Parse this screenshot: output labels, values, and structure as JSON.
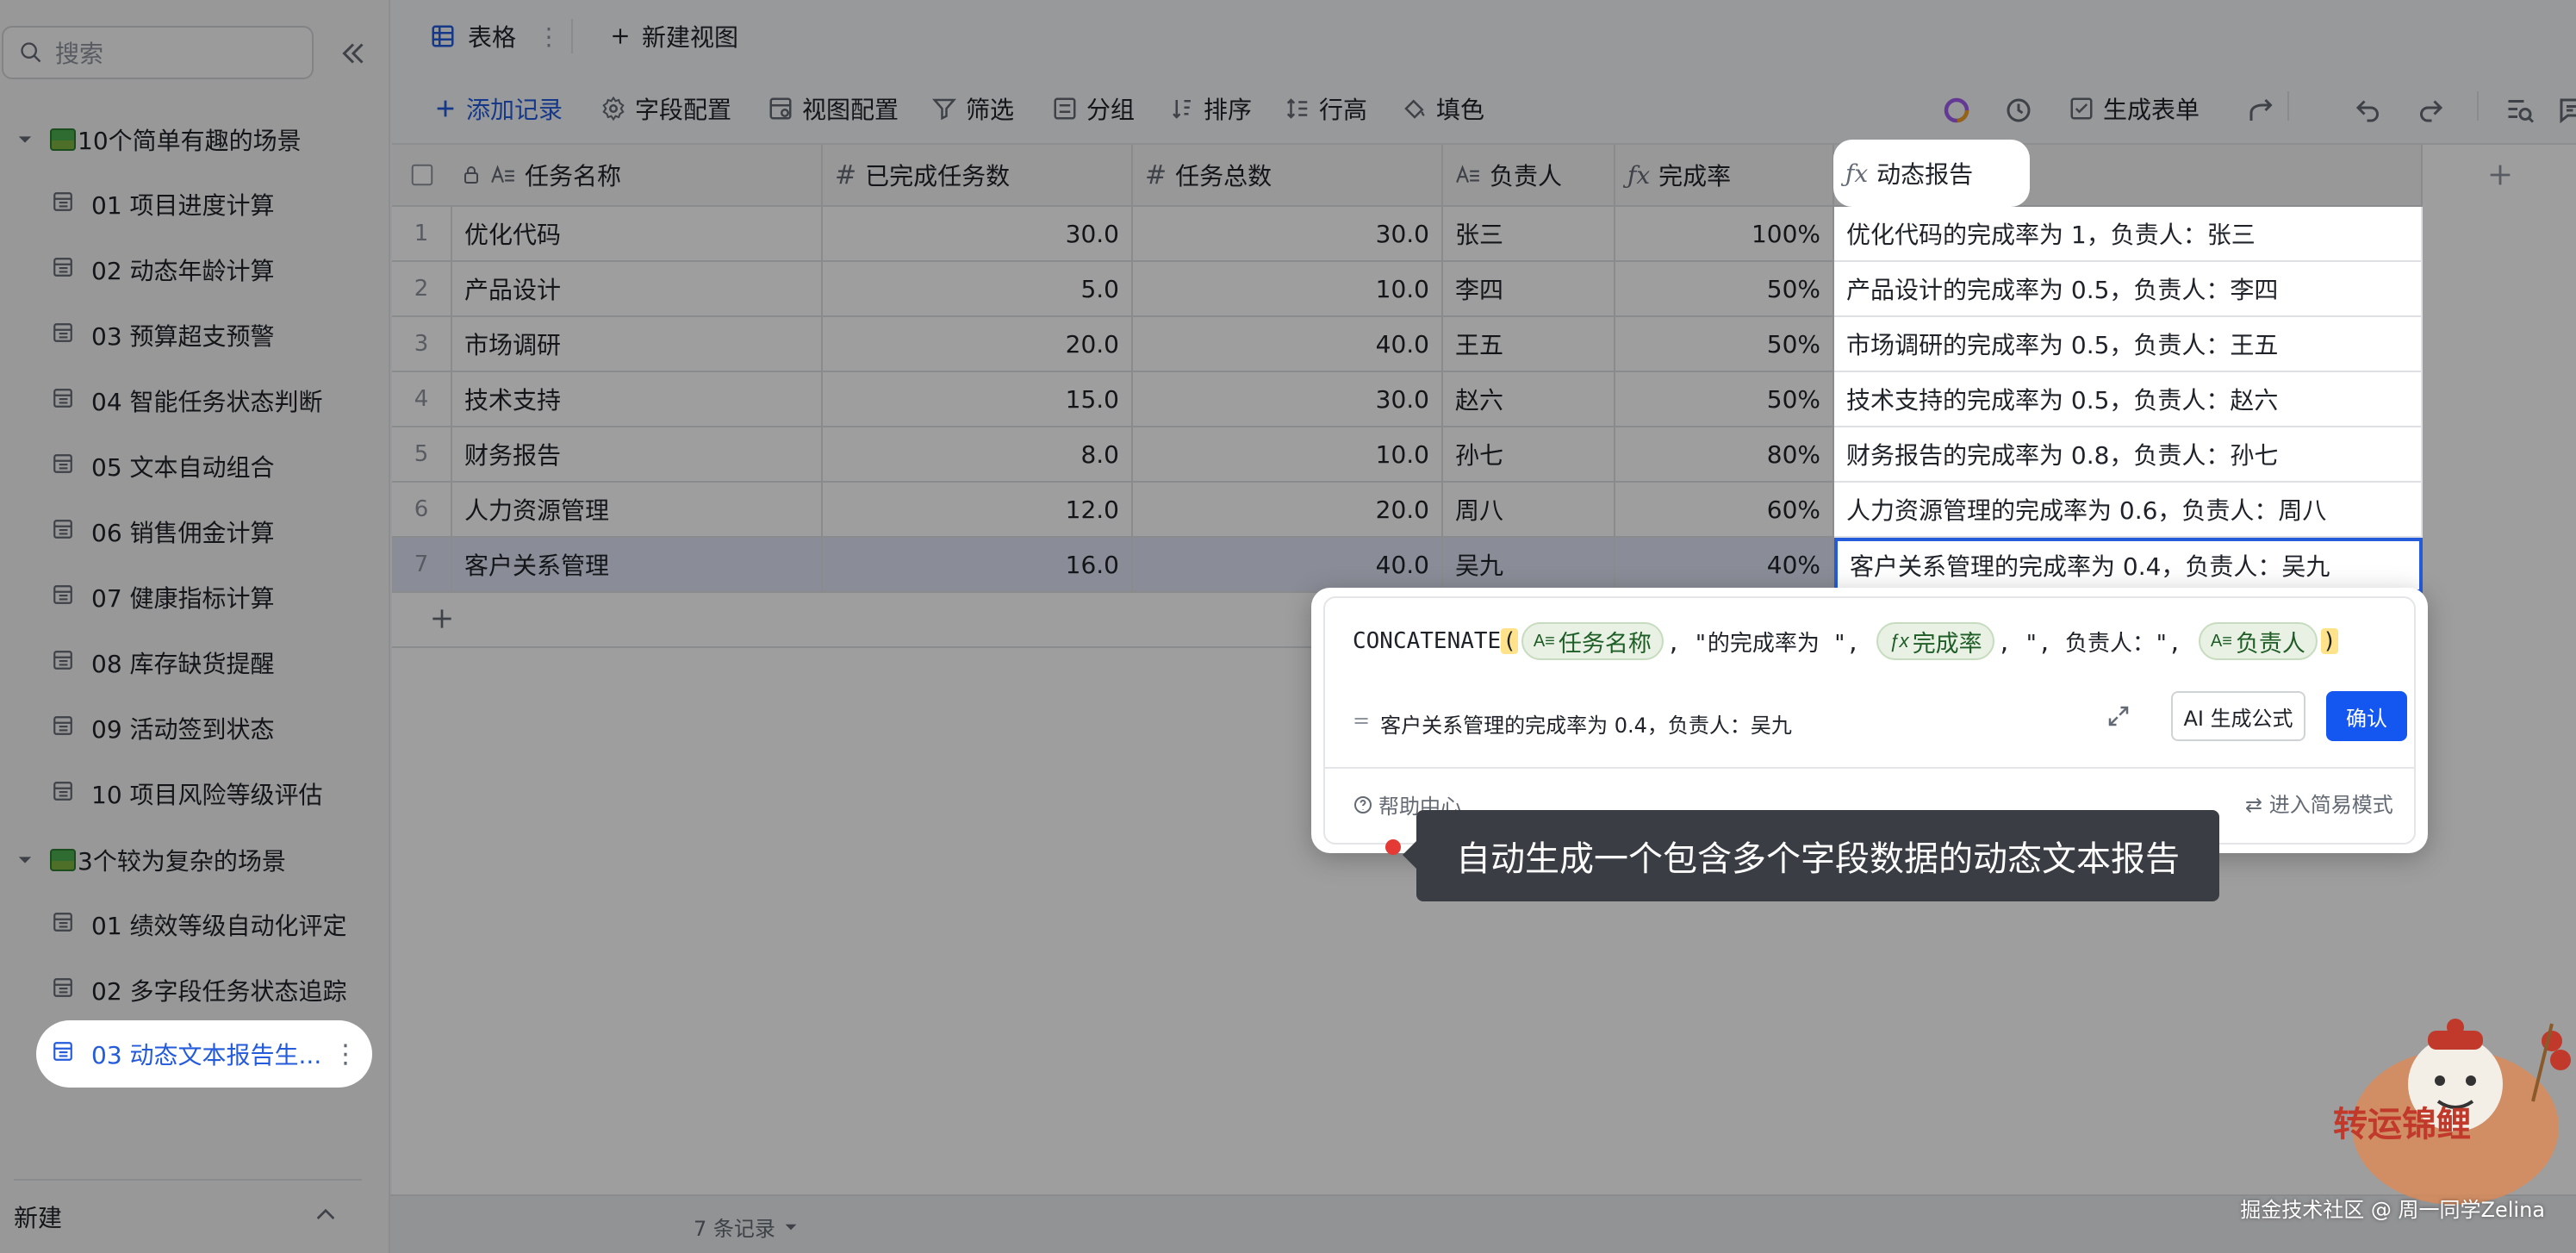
{
  "sidebar": {
    "search_placeholder": "搜索",
    "groups": [
      {
        "label": "10个简单有趣的场景"
      },
      {
        "label": "3个较为复杂的场景"
      }
    ],
    "items": [
      "01 项目进度计算",
      "02 动态年龄计算",
      "03 预算超支预警",
      "04 智能任务状态判断",
      "05 文本自动组合",
      "06 销售佣金计算",
      "07 健康指标计算",
      "08 库存缺货提醒",
      "09 活动签到状态",
      "10 项目风险等级评估",
      "01 绩效等级自动化评定",
      "02 多字段任务状态追踪",
      "03 动态文本报告生..."
    ],
    "new_label": "新建"
  },
  "tabs": {
    "table_label": "表格",
    "new_view_label": "新建视图"
  },
  "toolbar": {
    "add_record": "添加记录",
    "field_config": "字段配置",
    "view_config": "视图配置",
    "filter": "筛选",
    "group": "分组",
    "sort": "排序",
    "row_height": "行高",
    "fill_color": "填色",
    "generate_form": "生成表单"
  },
  "columns": {
    "name": "任务名称",
    "done": "已完成任务数",
    "total": "任务总数",
    "owner": "负责人",
    "rate": "完成率",
    "report": "动态报告"
  },
  "rows": [
    {
      "idx": "1",
      "name": "优化代码",
      "done": "30.0",
      "total": "30.0",
      "owner": "张三",
      "rate": "100%",
      "report": "优化代码的完成率为 1，负责人：张三"
    },
    {
      "idx": "2",
      "name": "产品设计",
      "done": "5.0",
      "total": "10.0",
      "owner": "李四",
      "rate": "50%",
      "report": "产品设计的完成率为 0.5，负责人：李四"
    },
    {
      "idx": "3",
      "name": "市场调研",
      "done": "20.0",
      "total": "40.0",
      "owner": "王五",
      "rate": "50%",
      "report": "市场调研的完成率为 0.5，负责人：王五"
    },
    {
      "idx": "4",
      "name": "技术支持",
      "done": "15.0",
      "total": "30.0",
      "owner": "赵六",
      "rate": "50%",
      "report": "技术支持的完成率为 0.5，负责人：赵六"
    },
    {
      "idx": "5",
      "name": "财务报告",
      "done": "8.0",
      "total": "10.0",
      "owner": "孙七",
      "rate": "80%",
      "report": "财务报告的完成率为 0.8，负责人：孙七"
    },
    {
      "idx": "6",
      "name": "人力资源管理",
      "done": "12.0",
      "total": "20.0",
      "owner": "周八",
      "rate": "60%",
      "report": "人力资源管理的完成率为 0.6，负责人：周八"
    },
    {
      "idx": "7",
      "name": "客户关系管理",
      "done": "16.0",
      "total": "40.0",
      "owner": "吴九",
      "rate": "40%",
      "report": "客户关系管理的完成率为 0.4，负责人：吴九"
    }
  ],
  "formula": {
    "fn": "CONCATENATE",
    "open": "(",
    "chip1": "任务名称",
    "lit1": ", \"的完成率为 \", ",
    "chip2": "完成率",
    "lit2": ", \", 负责人：\", ",
    "chip3": "负责人",
    "close": ")",
    "result": "客户关系管理的完成率为 0.4，负责人：吴九",
    "ai_button": "AI 生成公式",
    "confirm_button": "确认",
    "help": "帮助中心",
    "simple_mode": "进入简易模式"
  },
  "tooltip": "自动生成一个包含多个字段数据的动态文本报告",
  "footer": {
    "records": "7 条记录"
  },
  "watermark": "掘金技术社区 @ 周一同学Zelina",
  "mascot_text": "转运锦鲤"
}
